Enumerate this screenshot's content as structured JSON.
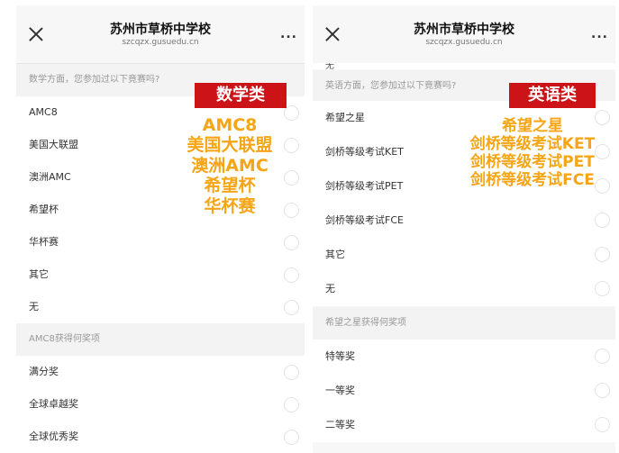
{
  "left": {
    "title": "苏州市草桥中学校",
    "url": "szcqzx.gusuedu.cn",
    "more": "...",
    "section1": "数学方面，您参加过以下竟赛吗?",
    "options1": [
      "AMC8",
      "美国大联盟",
      "澳洲AMC",
      "希望杯",
      "华杯赛",
      "其它",
      "无"
    ],
    "section2": "AMC8获得何奖项",
    "options2": [
      "满分奖",
      "全球卓越奖",
      "全球优秀奖"
    ],
    "badge": "数学类",
    "overlay": [
      "AMC8",
      "美国大联盟",
      "澳洲AMC",
      "希望杯",
      "华杯赛"
    ]
  },
  "right": {
    "title": "苏州市草桥中学校",
    "url": "szcqzx.gusuedu.cn",
    "more": "...",
    "cut_label": "无",
    "section1": "英语方面，您参加过以下竟赛吗?",
    "options1": [
      "希望之星",
      "剑桥等级考试KET",
      "剑桥等级考试PET",
      "剑桥等级考试FCE",
      "其它",
      "无"
    ],
    "section2": "希望之星获得何奖项",
    "options2": [
      "特等奖",
      "一等奖",
      "二等奖"
    ],
    "badge": "英语类",
    "overlay": [
      "希望之星",
      "剑桥等级考试KET",
      "剑桥等级考试PET",
      "剑桥等级考试FCE"
    ]
  },
  "colors": {
    "badge_red": "#cc1418",
    "overlay_orange": "#f5a515"
  }
}
